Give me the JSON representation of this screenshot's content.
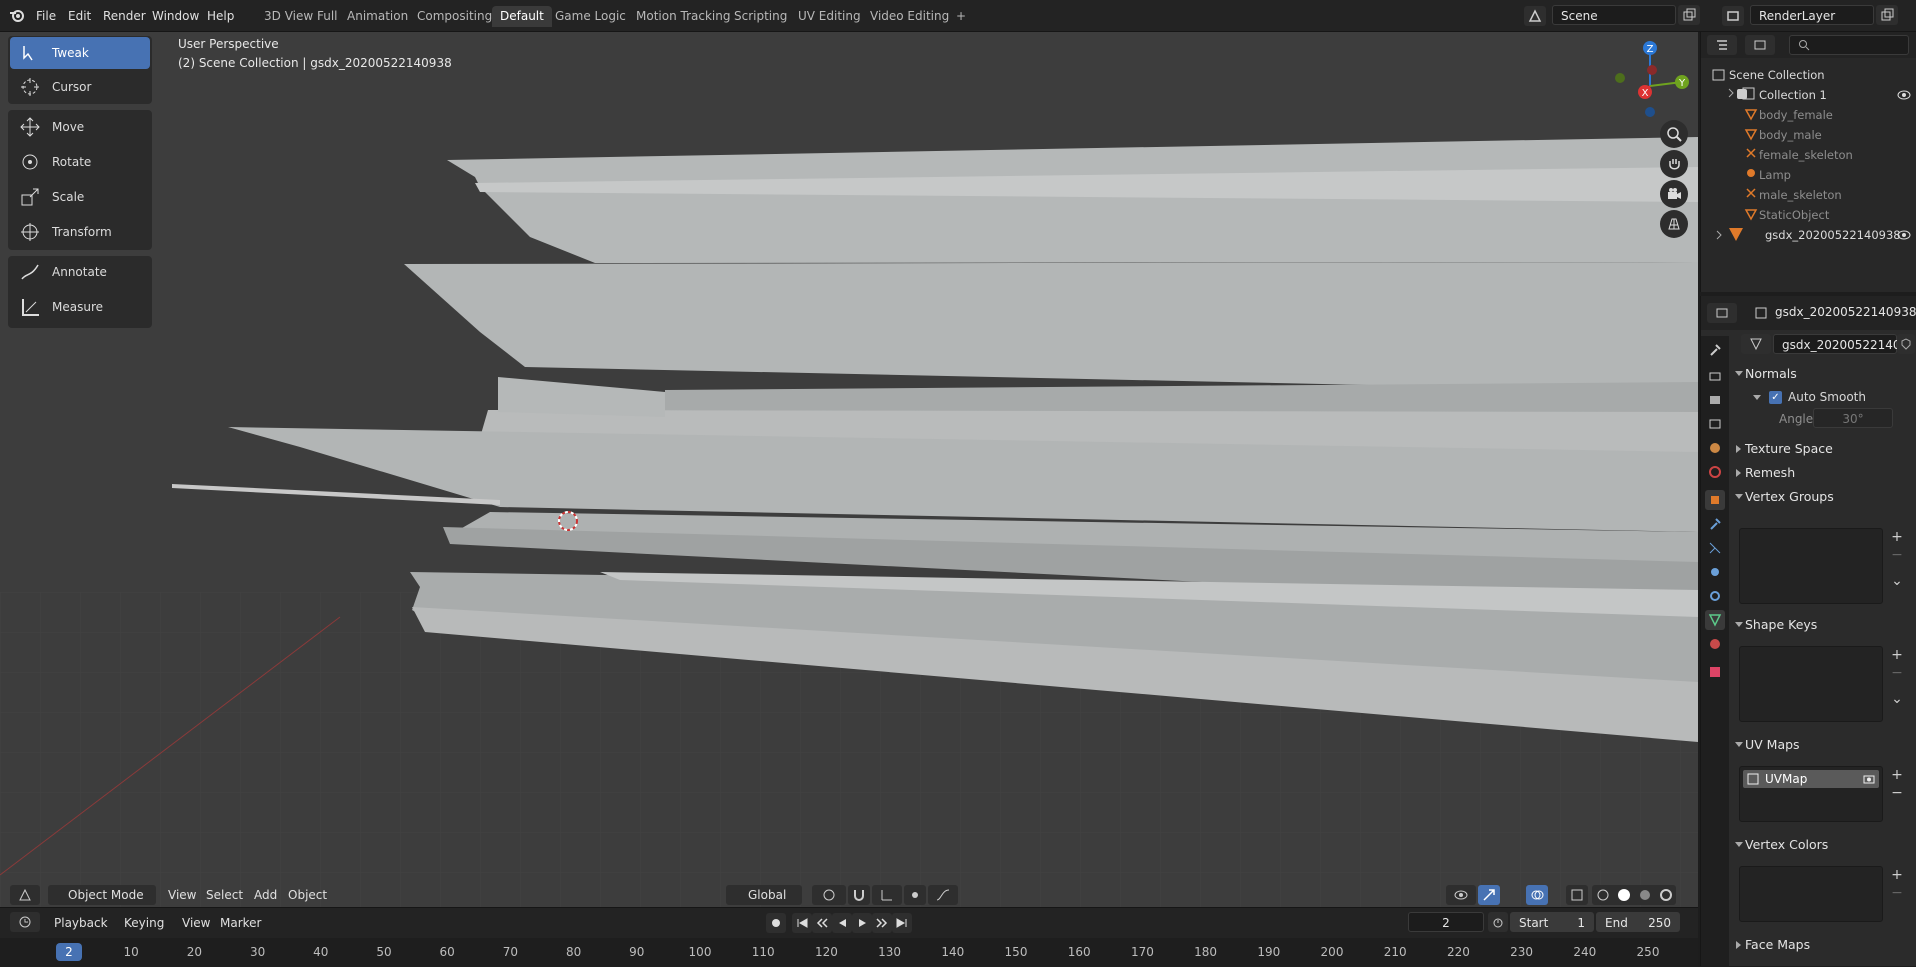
{
  "topbar": {
    "menus": [
      "File",
      "Edit",
      "Render",
      "Window",
      "Help"
    ],
    "workspaces": [
      "3D View Full",
      "Animation",
      "Compositing",
      "Default",
      "Game Logic",
      "Motion Tracking",
      "Scripting",
      "UV Editing",
      "Video Editing"
    ],
    "active_workspace": "Default",
    "add_tab": "+",
    "scene": "Scene",
    "render_layer": "RenderLayer"
  },
  "viewport": {
    "perspective": "User Perspective",
    "collection_info": "(2) Scene Collection | gsdx_20200522140938",
    "tools": [
      "Tweak",
      "Cursor",
      "Move",
      "Rotate",
      "Scale",
      "Transform",
      "Annotate",
      "Measure"
    ],
    "header": {
      "mode": "Object Mode",
      "view": "View",
      "select": "Select",
      "add": "Add",
      "object": "Object",
      "orientation": "Global"
    },
    "gizmo": {
      "z": "Z",
      "y": "Y",
      "x": "X"
    }
  },
  "timeline": {
    "playback": "Playback",
    "keying": "Keying",
    "view": "View",
    "marker": "Marker",
    "current_frame": "2",
    "start_label": "Start",
    "start": "1",
    "end_label": "End",
    "end": "250",
    "ticks": [
      "10",
      "20",
      "30",
      "40",
      "50",
      "60",
      "70",
      "80",
      "90",
      "100",
      "110",
      "120",
      "130",
      "140",
      "150",
      "160",
      "170",
      "180",
      "190",
      "200",
      "210",
      "220",
      "230",
      "240",
      "250"
    ],
    "ticks_values": [
      10,
      20,
      30,
      40,
      50,
      60,
      70,
      80,
      90,
      100,
      110,
      120,
      130,
      140,
      150,
      160,
      170,
      180,
      190,
      200,
      210,
      220,
      230,
      240,
      250
    ]
  },
  "outliner": {
    "root": "Scene Collection",
    "collection": "Collection 1",
    "items": [
      "body_female",
      "body_male",
      "female_skeleton",
      "Lamp",
      "male_skeleton",
      "StaticObject"
    ],
    "extra": "gsdx_20200522140938"
  },
  "properties": {
    "object_name": "gsdx_20200522140938",
    "mesh_name": "gsdx_20200522140...",
    "panels": {
      "normals": "Normals",
      "auto_smooth": "Auto Smooth",
      "angle_label": "Angle",
      "angle_value": "30°",
      "texture_space": "Texture Space",
      "remesh": "Remesh",
      "vertex_groups": "Vertex Groups",
      "shape_keys": "Shape Keys",
      "uv_maps": "UV Maps",
      "uv_map_item": "UVMap",
      "vertex_colors": "Vertex Colors",
      "face_maps": "Face Maps"
    }
  },
  "colors": {
    "accent": "#4772b3",
    "viewport_bg": "#3d3d3d",
    "panel": "#2b2b2b"
  }
}
